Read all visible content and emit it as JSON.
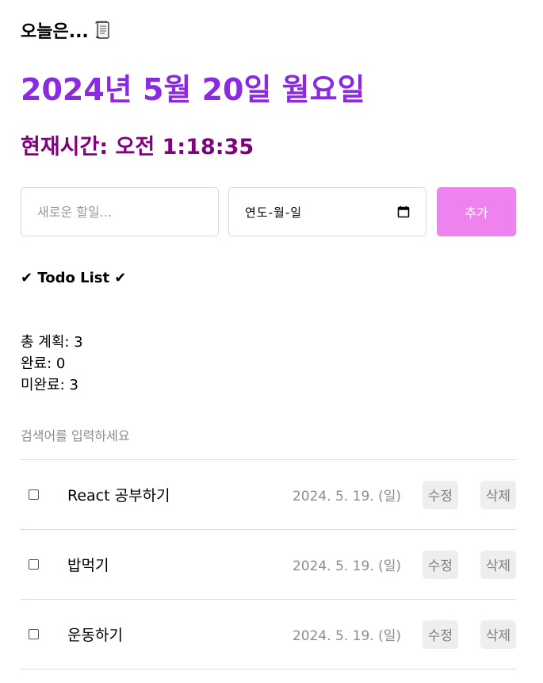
{
  "header": {
    "greeting": "오늘은...",
    "icon": "scroll-icon",
    "date": "2024년 5월 20일 월요일",
    "clock": "현재시간: 오전 1:18:35"
  },
  "editor": {
    "placeholder": "새로운 할일...",
    "date_display": "연도-월-일",
    "add_label": "추가"
  },
  "list": {
    "title": "✔ Todo List ✔",
    "stats": {
      "total": "총 계획: 3",
      "done": "완료: 0",
      "undone": "미완료: 3"
    },
    "search_placeholder": "검색어를 입력하세요",
    "items": [
      {
        "content": "React 공부하기",
        "date": "2024. 5. 19. (일)",
        "edit": "수정",
        "delete": "삭제"
      },
      {
        "content": "밥먹기",
        "date": "2024. 5. 19. (일)",
        "edit": "수정",
        "delete": "삭제"
      },
      {
        "content": "운동하기",
        "date": "2024. 5. 19. (일)",
        "edit": "수정",
        "delete": "삭제"
      }
    ]
  },
  "colors": {
    "title": "#8a2be2",
    "clock": "#800080",
    "add_button": "#ee82ee"
  }
}
